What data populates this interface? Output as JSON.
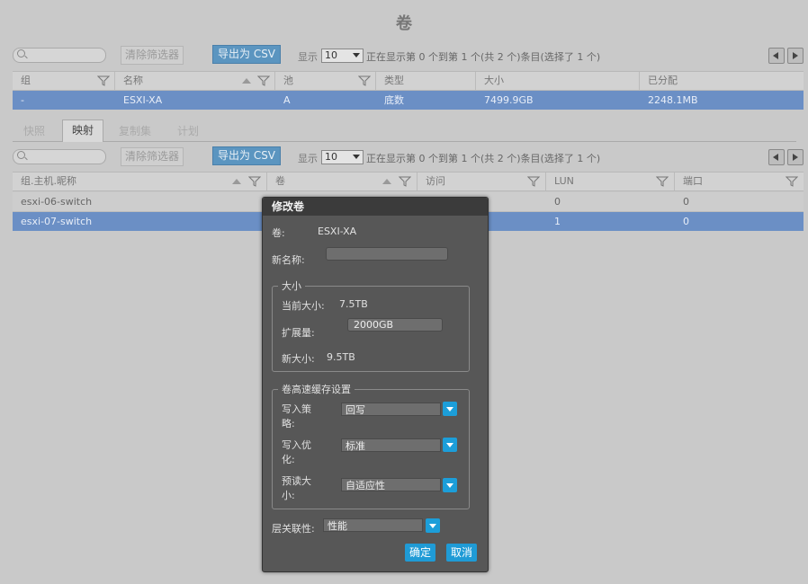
{
  "page_title": "卷",
  "toolbar1": {
    "clear_filter": "清除筛选器",
    "export_csv": "导出为 CSV",
    "show_label": "显示",
    "show_value": "10",
    "status": "正在显示第 0 个到第 1 个(共 2 个)条目(选择了 1 个)"
  },
  "volumes_table": {
    "headers": [
      "组",
      "名称",
      "池",
      "类型",
      "大小",
      "已分配"
    ],
    "rows": [
      [
        "-",
        "ESXI-XA",
        "A",
        "底数",
        "7499.9GB",
        "2248.1MB"
      ]
    ]
  },
  "tabs": [
    "快照",
    "映射",
    "复制集",
    "计划"
  ],
  "toolbar2": {
    "clear_filter": "清除筛选器",
    "export_csv": "导出为 CSV",
    "show_label": "显示",
    "show_value": "10",
    "status": "正在显示第 0 个到第 1 个(共 2 个)条目(选择了 1 个)"
  },
  "mapping_table": {
    "headers": [
      "组.主机.昵称",
      "卷",
      "访问",
      "LUN",
      "端口"
    ],
    "rows": [
      [
        "esxi-06-switch",
        "",
        "",
        "0",
        "0"
      ],
      [
        "esxi-07-switch",
        "",
        "",
        "1",
        "0"
      ]
    ]
  },
  "dialog": {
    "title": "修改卷",
    "volume_label": "卷:",
    "volume_value": "ESXI-XA",
    "new_name_label": "新名称:",
    "new_name_value": "",
    "size_legend": "大小",
    "current_size_label": "当前大小:",
    "current_size_value": "7.5TB",
    "expand_label": "扩展量:",
    "expand_value": "2000GB",
    "new_size_label": "新大小:",
    "new_size_value": "9.5TB",
    "cache_legend": "卷高速缓存设置",
    "write_policy_label_1": "写入策",
    "write_policy_label_2": "略:",
    "write_policy_value": "回写",
    "write_opt_label_1": "写入优",
    "write_opt_label_2": "化:",
    "write_opt_value": "标准",
    "readahead_label_1": "预读大",
    "readahead_label_2": "小:",
    "readahead_value": "自适应性",
    "tier_label": "层关联性:",
    "tier_value": "性能",
    "ok": "确定",
    "cancel": "取消"
  },
  "colors": {
    "selected_row": "#6b8fc5",
    "csv_button": "#5b95c0",
    "dialog_button": "#1f9bd6"
  }
}
